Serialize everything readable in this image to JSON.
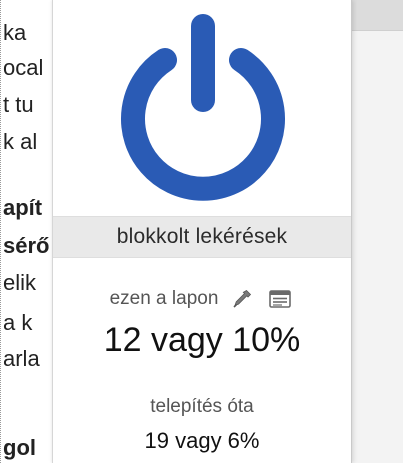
{
  "background_page": {
    "lines": [
      {
        "text": "ka",
        "bold": false
      },
      {
        "text": "ocal",
        "bold": false
      },
      {
        "text": "t tu",
        "bold": false
      },
      {
        "text": "k al",
        "bold": false
      },
      {
        "text": "apít",
        "bold": true
      },
      {
        "text": "sérő",
        "bold": true
      },
      {
        "text": "elik",
        "bold": false
      },
      {
        "text": "a k",
        "bold": false
      },
      {
        "text": "arla",
        "bold": false
      },
      {
        "text": "gol",
        "bold": true
      }
    ]
  },
  "popup": {
    "power_button": {
      "icon": "power-icon",
      "color": "#2a5bb5"
    },
    "blocked_requests_label": "blokkolt lekérések",
    "on_this_page": {
      "label": "ezen a lapon",
      "picker_icon": "eyedropper-icon",
      "logger_icon": "list-icon",
      "value": "12 vagy 10%"
    },
    "since_install": {
      "label": "telepítés óta",
      "value": "19 vagy 6%"
    }
  },
  "colors": {
    "accent": "#2a5bb5",
    "band": "#e9e9e9",
    "label_grey": "#555555",
    "text_dark": "#111111"
  }
}
